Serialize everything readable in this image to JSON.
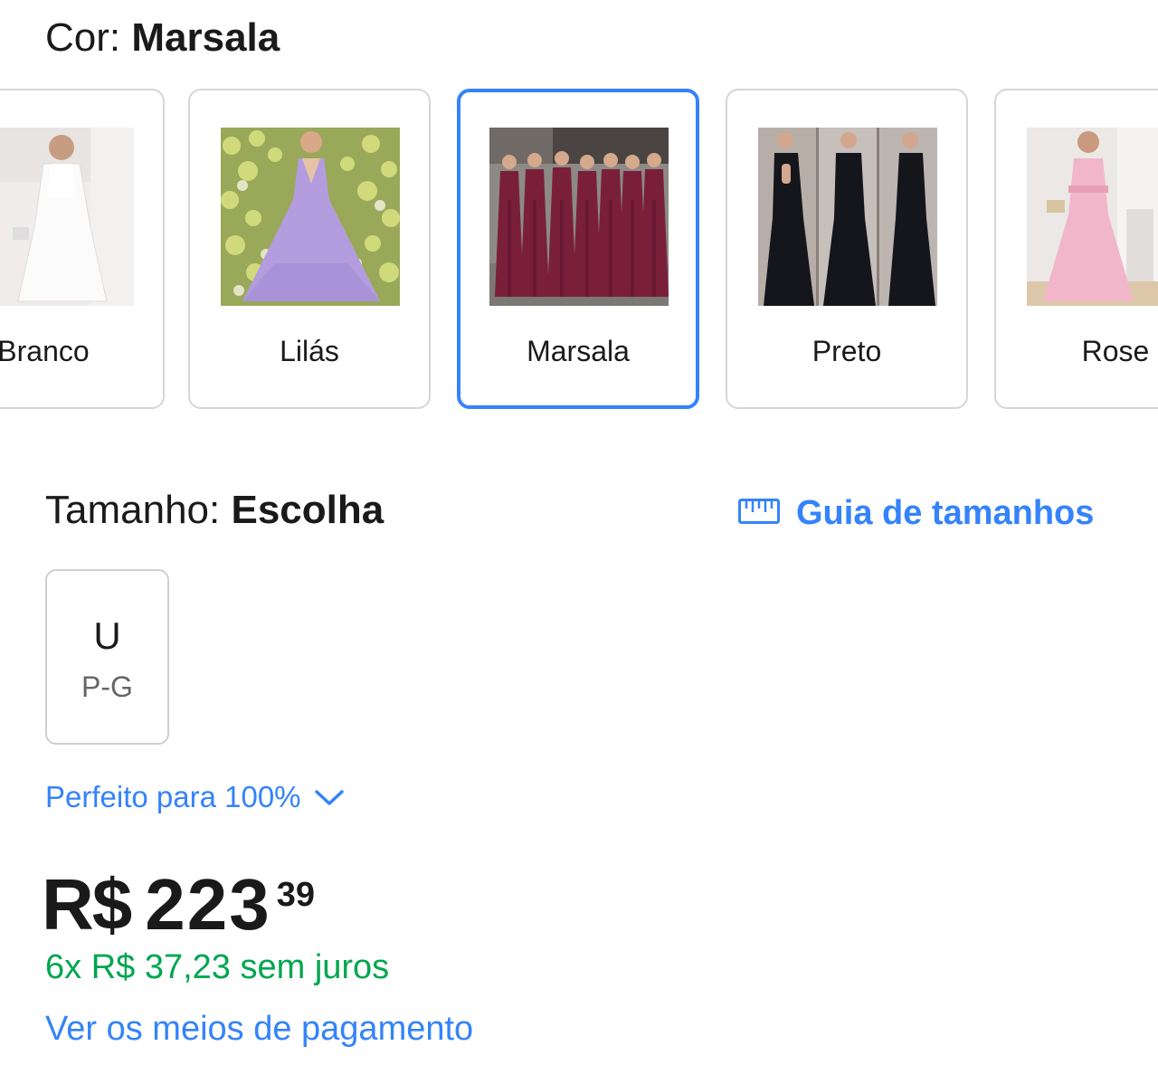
{
  "color": {
    "label": "Cor: ",
    "selected": "Marsala",
    "options": [
      {
        "label": "Branco",
        "selected": false
      },
      {
        "label": "Lilás",
        "selected": false
      },
      {
        "label": "Marsala",
        "selected": true
      },
      {
        "label": "Preto",
        "selected": false
      },
      {
        "label": "Rose",
        "selected": false
      }
    ]
  },
  "size": {
    "label": "Tamanho: ",
    "selected": "Escolha",
    "guide_label": "Guia de tamanhos",
    "options": [
      {
        "main": "U",
        "sub": "P-G"
      }
    ],
    "fit_label": "Perfeito para 100%"
  },
  "price": {
    "currency": "R$",
    "integer": "223",
    "cents": "39",
    "installments": "6x R$ 37,23 sem juros",
    "payment_link": "Ver os meios de pagamento"
  },
  "colors": {
    "accent": "#3483fa",
    "installments": "#00a650",
    "border": "#d6d6d6"
  },
  "icons": {
    "size_guide": "ruler-icon",
    "fit_toggle": "chevron-down-icon"
  }
}
